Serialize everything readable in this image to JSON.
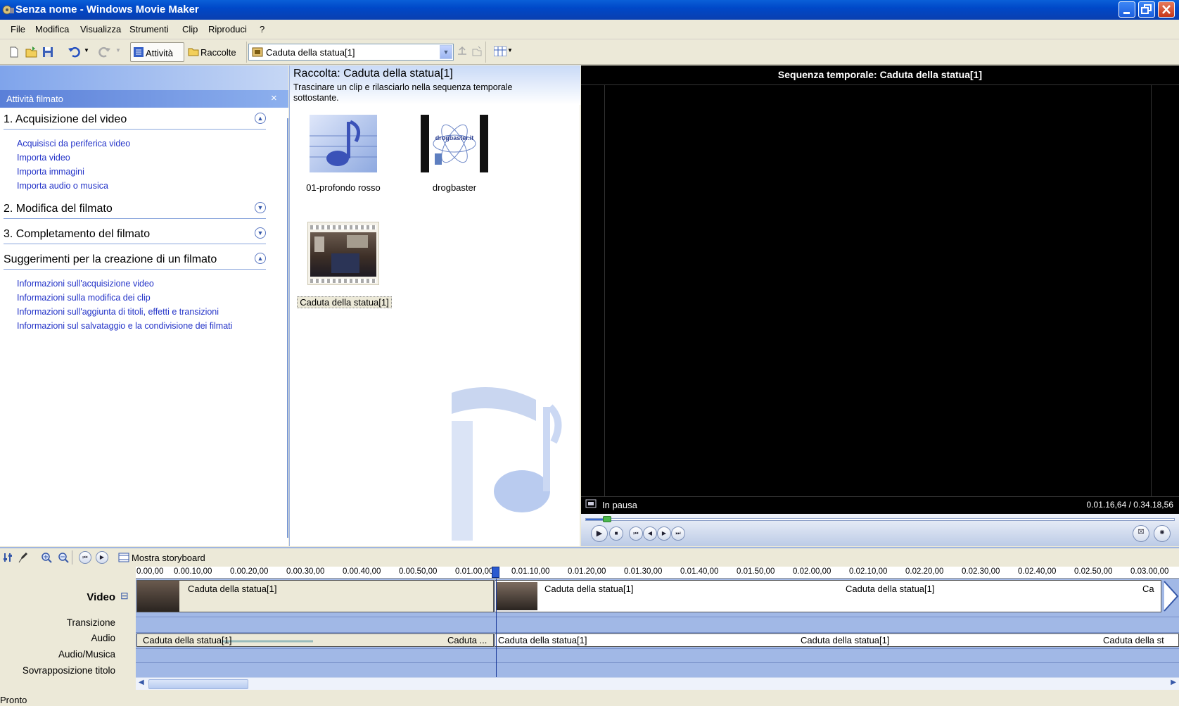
{
  "window": {
    "title": "Senza nome - Windows Movie Maker"
  },
  "menu": [
    "File",
    "Modifica",
    "Visualizza",
    "Strumenti",
    "Clip",
    "Riproduci",
    "?"
  ],
  "toolbar": {
    "tasks_label": "Attività",
    "collections_label": "Raccolte",
    "collection_select": "Caduta della statua[1]"
  },
  "tasks_pane": {
    "header": "Attività filmato",
    "close": "×",
    "sections": [
      {
        "title": "1. Acquisizione del video",
        "expanded": true,
        "links": [
          "Acquisisci da periferica video",
          "Importa video",
          "Importa immagini",
          "Importa audio o musica"
        ]
      },
      {
        "title": "2. Modifica del filmato",
        "expanded": false,
        "links": []
      },
      {
        "title": "3. Completamento del filmato",
        "expanded": false,
        "links": []
      },
      {
        "title": "Suggerimenti per la creazione di un filmato",
        "expanded": true,
        "links": [
          "Informazioni sull'acquisizione video",
          "Informazioni sulla modifica dei clip",
          "Informazioni sull'aggiunta di titoli, effetti e transizioni",
          "Informazioni sul salvataggio e la condivisione dei filmati"
        ]
      }
    ]
  },
  "collection": {
    "title": "Raccolta: Caduta della statua[1]",
    "hint": "Trascinare un clip e rilasciarlo nella sequenza temporale sottostante.",
    "items": [
      "01-profondo rosso",
      "drogbaster",
      "Caduta della statua[1]"
    ],
    "logo_text": "drogbaster.it"
  },
  "preview": {
    "title": "Sequenza temporale: Caduta della statua[1]",
    "status": "In pausa",
    "time": "0.01.16,64 / 0.34.18,56",
    "progress": 0.037
  },
  "timeline": {
    "storyboard_label": "Mostra storyboard",
    "ruler": [
      "0.00,00",
      "0.00.10,00",
      "0.00.20,00",
      "0.00.30,00",
      "0.00.40,00",
      "0.00.50,00",
      "0.01.00,00",
      "0.01.10,00",
      "0.01.20,00",
      "0.01.30,00",
      "0.01.40,00",
      "0.01.50,00",
      "0.02.00,00",
      "0.02.10,00",
      "0.02.20,00",
      "0.02.30,00",
      "0.02.40,00",
      "0.02.50,00",
      "0.03.00,00"
    ],
    "tracks": [
      "Video",
      "Transizione",
      "Audio",
      "Audio/Musica",
      "Sovrapposizione titolo"
    ],
    "collapse": "⊟",
    "video_clips": [
      "Caduta della statua[1]",
      "Caduta della statua[1]",
      "Caduta della statua[1]",
      "Ca"
    ],
    "audio_clips": [
      "Caduta della statua[1]",
      "Caduta ...",
      "Caduta della statua[1]",
      "Caduta della statua[1]",
      "Caduta della st"
    ]
  },
  "status_bar": "Pronto"
}
